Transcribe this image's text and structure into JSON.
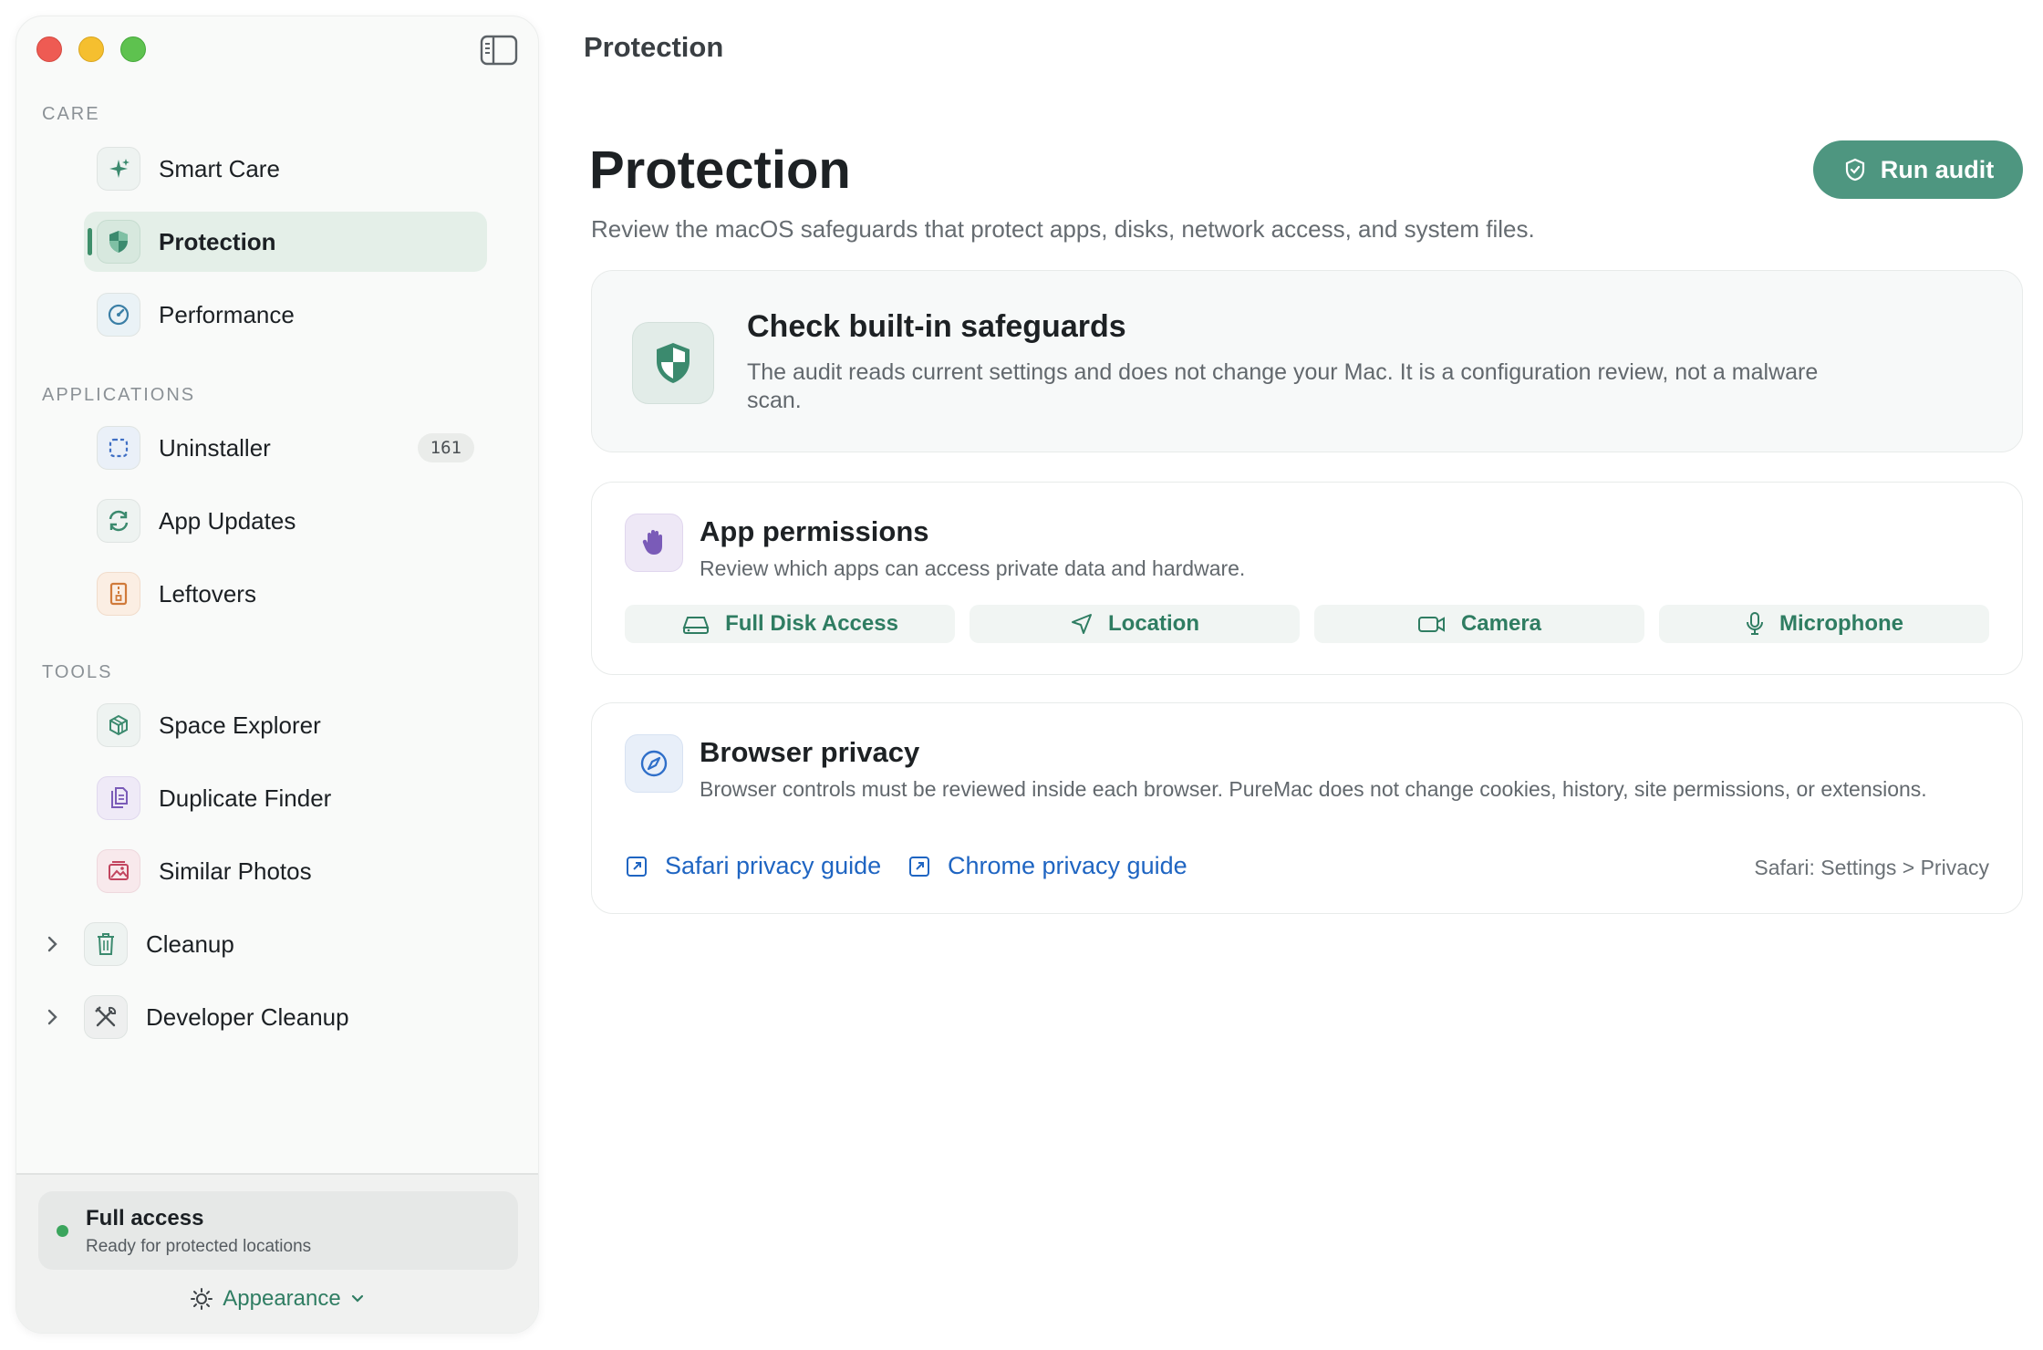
{
  "window": {
    "title": "Protection"
  },
  "sidebar": {
    "sections": {
      "care": "CARE",
      "applications": "APPLICATIONS",
      "tools": "TOOLS"
    },
    "care_items": [
      {
        "label": "Smart Care",
        "icon": "sparkle-icon"
      },
      {
        "label": "Protection",
        "icon": "shield-icon",
        "active": true
      },
      {
        "label": "Performance",
        "icon": "gauge-icon"
      }
    ],
    "application_items": [
      {
        "label": "Uninstaller",
        "icon": "uninstaller-icon",
        "badge": "161"
      },
      {
        "label": "App Updates",
        "icon": "refresh-icon"
      },
      {
        "label": "Leftovers",
        "icon": "archive-icon"
      }
    ],
    "tool_items": [
      {
        "label": "Space Explorer",
        "icon": "cube-icon"
      },
      {
        "label": "Duplicate Finder",
        "icon": "duplicate-icon"
      },
      {
        "label": "Similar Photos",
        "icon": "photos-icon"
      }
    ],
    "groups": [
      {
        "label": "Cleanup",
        "icon": "trash-icon"
      },
      {
        "label": "Developer Cleanup",
        "icon": "tools-icon"
      }
    ],
    "footer": {
      "access_title": "Full access",
      "access_subtitle": "Ready for protected locations",
      "appearance_label": "Appearance"
    }
  },
  "main": {
    "title": "Protection",
    "subtitle": "Review the macOS safeguards that protect apps, disks, network access, and system files.",
    "run_audit_label": "Run audit",
    "hero": {
      "title": "Check built-in safeguards",
      "body": "The audit reads current settings and does not change your Mac. It is a configuration review, not a malware scan."
    },
    "permissions": {
      "title": "App permissions",
      "description": "Review which apps can access private data and hardware.",
      "chips": [
        {
          "label": "Full Disk Access",
          "icon": "disk-icon"
        },
        {
          "label": "Location",
          "icon": "location-icon"
        },
        {
          "label": "Camera",
          "icon": "camera-icon"
        },
        {
          "label": "Microphone",
          "icon": "microphone-icon"
        }
      ]
    },
    "browser": {
      "title": "Browser privacy",
      "description": "Browser controls must be reviewed inside each browser. PureMac does not change cookies, history, site permissions, or extensions.",
      "links": [
        {
          "label": "Safari privacy guide",
          "icon": "external-link-icon"
        },
        {
          "label": "Chrome privacy guide",
          "icon": "external-link-icon"
        }
      ],
      "hint": "Safari: Settings > Privacy"
    }
  },
  "colors": {
    "accent": "#4e9680",
    "accent_text": "#2f7d62",
    "link": "#1f65c2",
    "active_bg": "#e4efe8",
    "status_green": "#3ba55d"
  }
}
